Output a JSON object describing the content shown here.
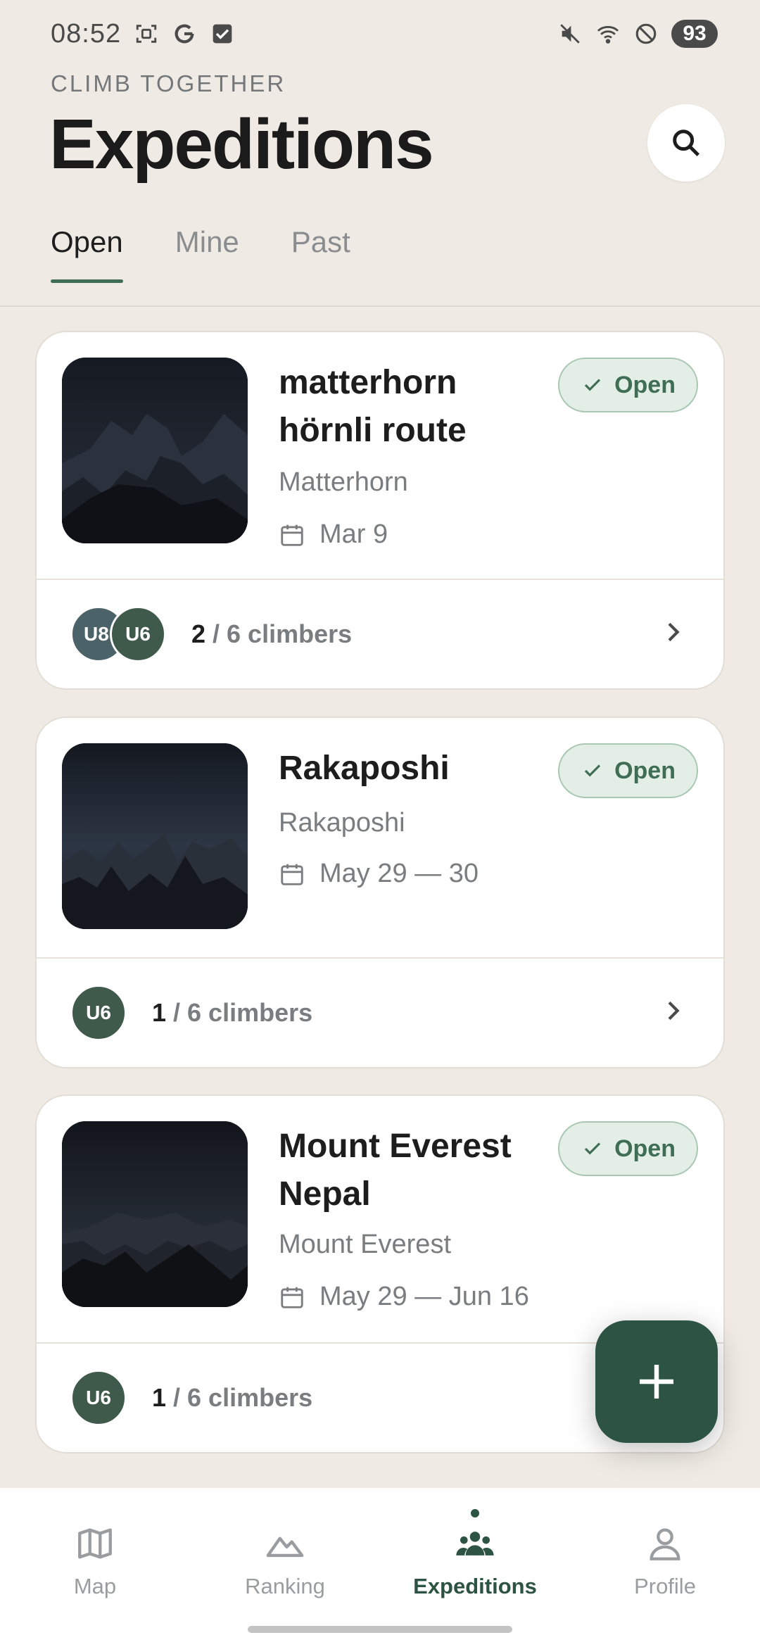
{
  "status_bar": {
    "time": "08:52",
    "battery": "93",
    "icons": [
      "screenshot-icon",
      "google-icon",
      "check-box-icon",
      "mute-icon",
      "wifi-icon",
      "dnd-icon"
    ]
  },
  "header": {
    "eyebrow": "CLIMB TOGETHER",
    "title": "Expeditions"
  },
  "tabs": [
    {
      "label": "Open",
      "active": true
    },
    {
      "label": "Mine",
      "active": false
    },
    {
      "label": "Past",
      "active": false
    }
  ],
  "expeditions": [
    {
      "title_line1": "matterhorn",
      "title_line2": "hörnli route",
      "mountain": "Matterhorn",
      "date": "Mar 9",
      "status": "Open",
      "avatars": [
        "U8",
        "U6"
      ],
      "climbers_count": "2",
      "climbers_rest": " / 6 climbers"
    },
    {
      "title_line1": "Rakaposhi",
      "title_line2": "",
      "mountain": "Rakaposhi",
      "date": "May 29 — 30",
      "status": "Open",
      "avatars": [
        "U6"
      ],
      "climbers_count": "1",
      "climbers_rest": " / 6 climbers"
    },
    {
      "title_line1": "Mount Everest",
      "title_line2": "Nepal",
      "mountain": "Mount Everest",
      "date": "May 29 — Jun 16",
      "status": "Open",
      "avatars": [
        "U6"
      ],
      "climbers_count": "1",
      "climbers_rest": " / 6 climbers"
    }
  ],
  "bottom_nav": [
    {
      "label": "Map",
      "icon": "map-icon",
      "active": false
    },
    {
      "label": "Ranking",
      "icon": "mountain-icon",
      "active": false
    },
    {
      "label": "Expeditions",
      "icon": "group-icon",
      "active": true
    },
    {
      "label": "Profile",
      "icon": "person-icon",
      "active": false
    }
  ],
  "colors": {
    "background": "#efebe4",
    "accent": "#2d5443",
    "badge_bg": "#e3eee6",
    "badge_text": "#3f6e55"
  }
}
